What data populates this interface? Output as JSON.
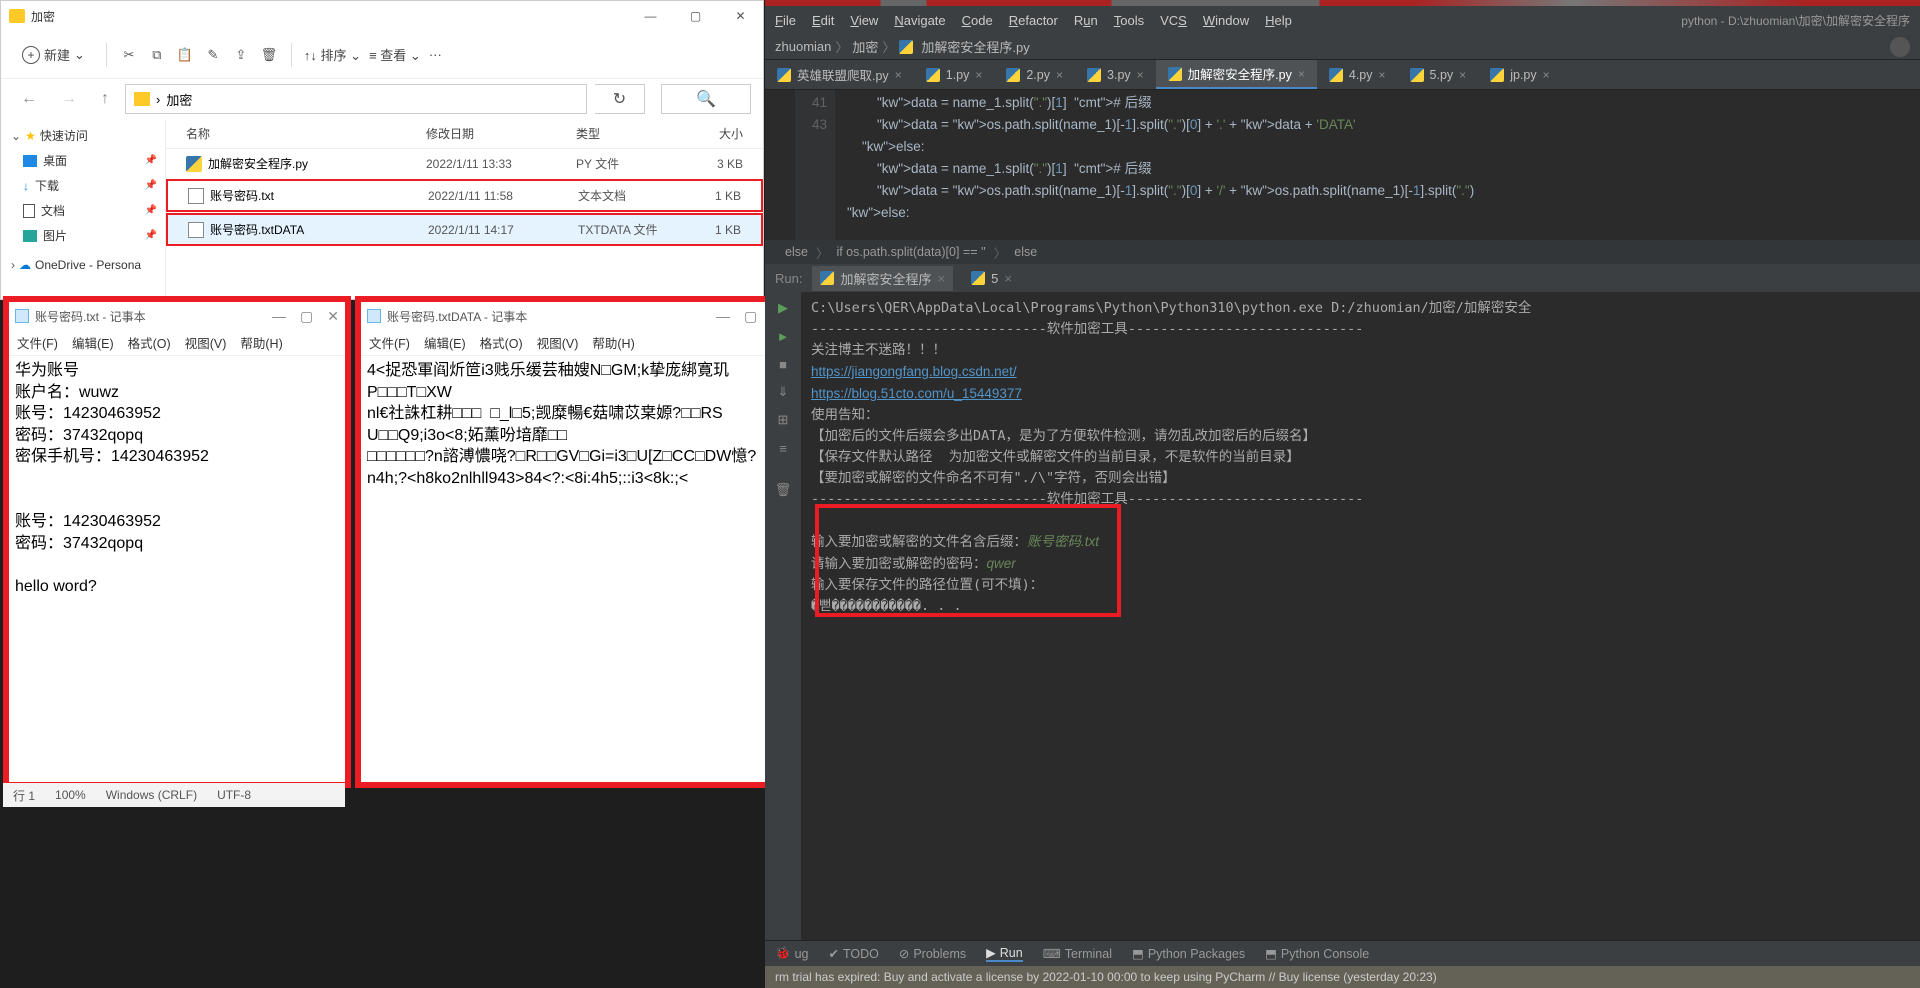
{
  "explorer": {
    "title": "加密",
    "new_btn": "新建",
    "sort_label": "排序",
    "view_label": "查看",
    "dots": "···",
    "path": "加密",
    "sidebar": {
      "quick": "快速访问",
      "desktop": "桌面",
      "downloads": "下载",
      "documents": "文档",
      "pictures": "图片",
      "onedrive": "OneDrive - Persona"
    },
    "columns": {
      "name": "名称",
      "date": "修改日期",
      "type": "类型",
      "size": "大小"
    },
    "rows": [
      {
        "name": "加解密安全程序.py",
        "date": "2022/1/11 13:33",
        "type": "PY 文件",
        "size": "3 KB",
        "icon": "py"
      },
      {
        "name": "账号密码.txt",
        "date": "2022/1/11 11:58",
        "type": "文本文档",
        "size": "1 KB",
        "icon": "txt"
      },
      {
        "name": "账号密码.txtDATA",
        "date": "2022/1/11 14:17",
        "type": "TXTDATA 文件",
        "size": "1 KB",
        "icon": "txt"
      }
    ]
  },
  "notepad1": {
    "title": "账号密码.txt - 记事本",
    "menu": [
      "文件(F)",
      "编辑(E)",
      "格式(O)",
      "视图(V)",
      "帮助(H)"
    ],
    "content": "华为账号\n账户名：wuwz\n账号：14230463952\n密码：37432qopq\n密保手机号：14230463952\n\n\n账号：14230463952\n密码：37432qopq\n\nhello word?",
    "status": {
      "line": "行 1",
      "zoom": "100%",
      "encoding": "Windows (CRLF)",
      "enc2": "UTF-8"
    }
  },
  "notepad2": {
    "title": "账号密码.txtDATA - 记事本",
    "menu": [
      "文件(F)",
      "编辑(E)",
      "格式(O)",
      "视图(V)",
      "帮助(H)"
    ],
    "content": "4<捉恐軍阎炘笸i3贱乐缓芸秞嫂N□GM;k挚庞綁寛玑P□□□T□XW\nnl€社誅杠耕□□□  □_l□5;觊糜暢€菇啸苡枽嫄?□□RS U□□Q9;i3o<8;妬薰吩堷靡□□\n□□□□□□?n諮溥憹哓?□R□□GV□Gi=i3□U[Z□CC□DW憶?n4h;?<h8ko2nlhll943>84<?:<8i:4h5;::i3<8k:;<"
  },
  "pycharm": {
    "menu": [
      "File",
      "Edit",
      "View",
      "Navigate",
      "Code",
      "Refactor",
      "Run",
      "Tools",
      "VCS",
      "Window",
      "Help"
    ],
    "title_path": "python - D:\\zhuomian\\加密\\加解密安全程序",
    "breadcrumb": [
      "zhuomian",
      "加密",
      "加解密安全程序.py"
    ],
    "tabs": [
      "英雄联盟爬取.py",
      "1.py",
      "2.py",
      "3.py",
      "加解密安全程序.py",
      "4.py",
      "5.py",
      "jp.py"
    ],
    "active_tab_index": 4,
    "gutter": [
      "",
      "41",
      "",
      "43",
      "",
      "",
      ""
    ],
    "code_lines": [
      "        data = name_1.split(\".\")[1]  # 后缀",
      "        data = os.path.split(name_1)[-1].split(\".\")[0] + '.' + data + 'DATA'",
      "    else:",
      "        data = name_1.split(\".\")[1]  # 后缀",
      "        data = os.path.split(name_1)[-1].split(\".\")[0] + '/' + os.path.split(name_1)[-1].split(\".\")",
      "else:"
    ],
    "crumb2": [
      "else",
      "if os.path.split(data)[0] == ''",
      "else"
    ],
    "run_tabs": [
      "加解密安全程序",
      "5"
    ],
    "console": {
      "exe": "C:\\Users\\QER\\AppData\\Local\\Programs\\Python\\Python310\\python.exe D:/zhuomian/加密/加解密安全",
      "sep": "-----------------------------软件加密工具-----------------------------",
      "follow": "关注博主不迷路！！！",
      "link1": "https://jiangongfang.blog.csdn.net/",
      "link2": "https://blog.51cto.com/u_15449377",
      "notice0": "使用告知：",
      "notice1": "【加密后的文件后缀会多出DATA，是为了方便软件检测，请勿乱改加密后的后缀名】",
      "notice2": "【保存文件默认路径  为加密文件或解密文件的当前目录，不是软件的当前目录】",
      "notice3": "【要加密或解密的文件命名不可有\"./\\\"字符，否则会出错】",
      "prompt1": "输入要加密或解密的文件名含后缀：",
      "input1": "账号密码.txt",
      "prompt2": "请输入要加密或解密的密码：",
      "input2": "qwer",
      "prompt3": "输入要保存文件的路径位置(可不填)：",
      "garbled": "�뻗�����������. . ."
    },
    "bottom": [
      "ug",
      "TODO",
      "Problems",
      "Run",
      "Terminal",
      "Python Packages",
      "Python Console"
    ],
    "status": "rm trial has expired: Buy and activate a license by 2022-01-10 00:00 to keep using PyCharm // Buy license (yesterday 20:23)",
    "run_side_label": "Run:"
  }
}
